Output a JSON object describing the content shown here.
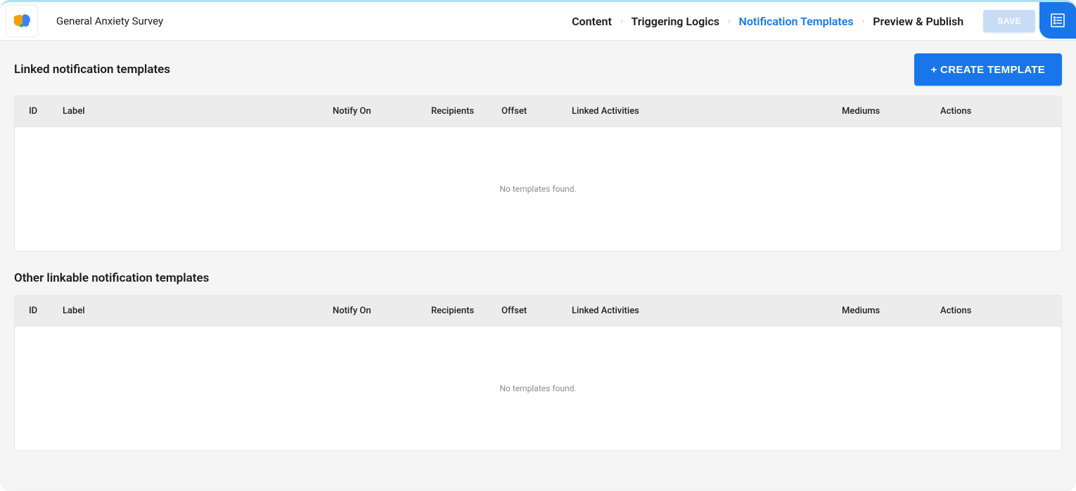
{
  "header": {
    "title": "General Anxiety Survey",
    "breadcrumb": {
      "content": "Content",
      "triggering": "Triggering Logics",
      "notification": "Notification Templates",
      "preview": "Preview & Publish",
      "active_index": 2
    },
    "save_label": "SAVE"
  },
  "sections": {
    "linked": {
      "title": "Linked notification templates",
      "create_label": "+ CREATE TEMPLATE",
      "empty_text": "No templates found."
    },
    "other": {
      "title": "Other linkable notification templates",
      "empty_text": "No templates found."
    }
  },
  "table_columns": {
    "id": "ID",
    "label": "Label",
    "notify_on": "Notify On",
    "recipients": "Recipients",
    "offset": "Offset",
    "linked_activities": "Linked Activities",
    "mediums": "Mediums",
    "actions": "Actions"
  }
}
